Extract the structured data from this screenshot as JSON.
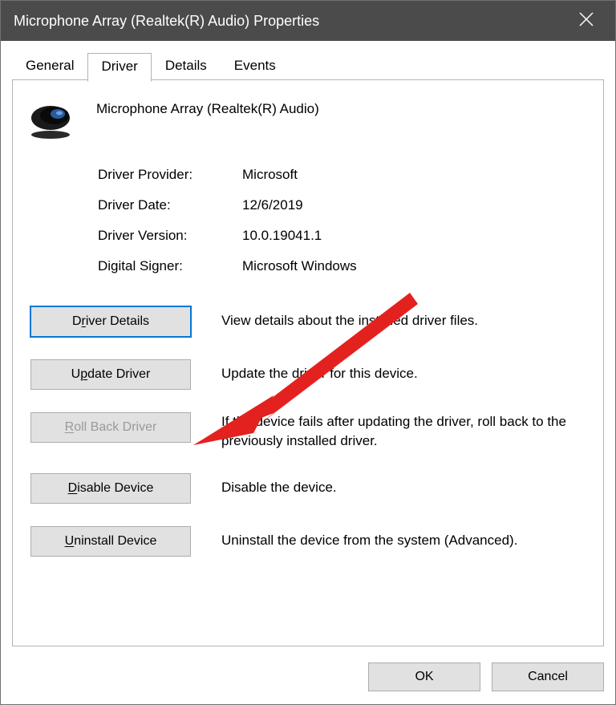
{
  "titlebar": {
    "title": "Microphone Array (Realtek(R) Audio) Properties"
  },
  "tabs": {
    "general": "General",
    "driver": "Driver",
    "details": "Details",
    "events": "Events",
    "active": "driver"
  },
  "device": {
    "name": "Microphone Array (Realtek(R) Audio)"
  },
  "info": {
    "provider_label": "Driver Provider:",
    "provider_value": "Microsoft",
    "date_label": "Driver Date:",
    "date_value": "12/6/2019",
    "version_label": "Driver Version:",
    "version_value": "10.0.19041.1",
    "signer_label": "Digital Signer:",
    "signer_value": "Microsoft Windows"
  },
  "actions": {
    "details_btn_pre": "D",
    "details_btn_u": "r",
    "details_btn_post": "iver Details",
    "details_desc": "View details about the installed driver files.",
    "update_btn_pre": "U",
    "update_btn_u": "p",
    "update_btn_post": "date Driver",
    "update_desc": "Update the driver for this device.",
    "rollback_btn_pre": "",
    "rollback_btn_u": "R",
    "rollback_btn_post": "oll Back Driver",
    "rollback_desc": "If the device fails after updating the driver, roll back to the previously installed driver.",
    "disable_btn_pre": "",
    "disable_btn_u": "D",
    "disable_btn_post": "isable Device",
    "disable_desc": "Disable the device.",
    "uninstall_btn_pre": "",
    "uninstall_btn_u": "U",
    "uninstall_btn_post": "ninstall Device",
    "uninstall_desc": "Uninstall the device from the system (Advanced)."
  },
  "dialog": {
    "ok": "OK",
    "cancel": "Cancel"
  }
}
